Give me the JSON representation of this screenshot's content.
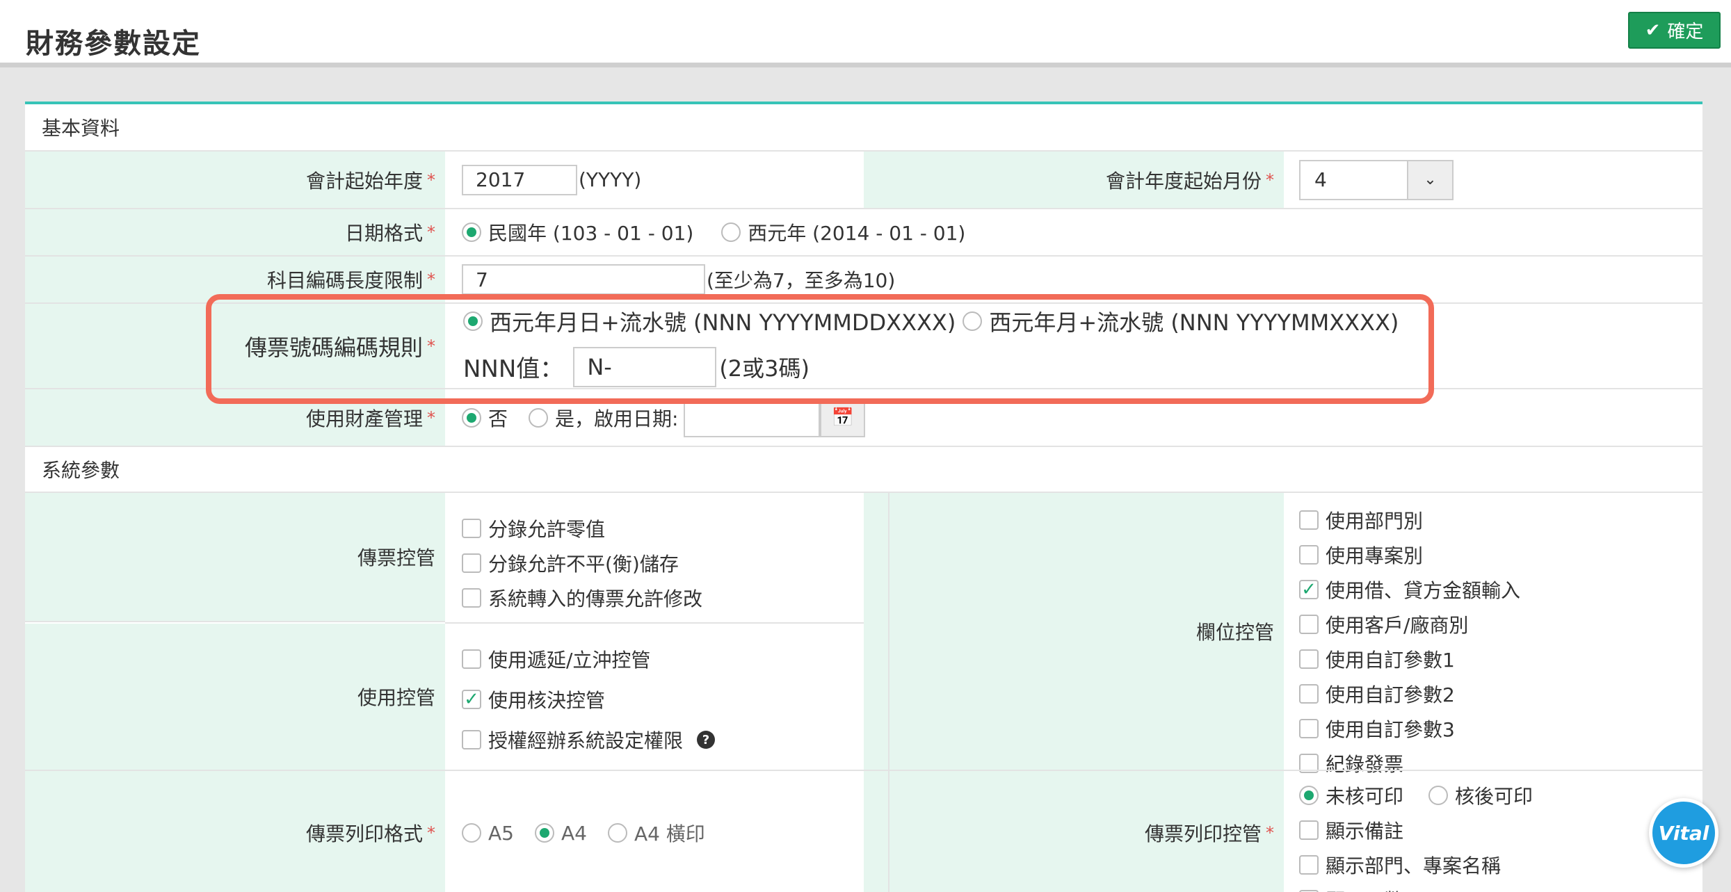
{
  "header": {
    "title": "財務參數設定",
    "confirm_label": "確定"
  },
  "basic": {
    "section_title": "基本資料",
    "fiscal_start_year": {
      "label": "會計起始年度",
      "value": "2017",
      "hint": "(YYYY)"
    },
    "fiscal_start_month": {
      "label": "會計年度起始月份",
      "value": "4"
    },
    "date_format": {
      "label": "日期格式",
      "options": [
        "民國年 (103 - 01 - 01)",
        "西元年 (2014 - 01 - 01)"
      ],
      "selected": 0
    },
    "account_code_length": {
      "label": "科目編碼長度限制",
      "value": "7",
      "hint": "(至少為7，至多為10)"
    },
    "voucher_number_rule": {
      "label": "傳票號碼編碼規則",
      "options": [
        "西元年月日+流水號 (NNN YYYYMMDDXXXX)",
        "西元年月+流水號 (NNN YYYYMMXXXX)"
      ],
      "selected": 0,
      "nnn_label": "NNN值：",
      "nnn_value": "N-",
      "nnn_hint": "(2或3碼)"
    },
    "asset_management": {
      "label": "使用財產管理",
      "options": [
        "否",
        "是，啟用日期:"
      ],
      "selected": 0,
      "date_value": ""
    }
  },
  "system": {
    "section_title": "系統參數",
    "voucher_control": {
      "label": "傳票控管",
      "items": [
        {
          "label": "分錄允許零值",
          "checked": false
        },
        {
          "label": "分錄允許不平(衡)儲存",
          "checked": false
        },
        {
          "label": "系統轉入的傳票允許修改",
          "checked": false
        }
      ]
    },
    "usage_control": {
      "label": "使用控管",
      "items": [
        {
          "label": "使用遞延/立沖控管",
          "checked": false
        },
        {
          "label": "使用核決控管",
          "checked": true
        },
        {
          "label": "授權經辦系統設定權限",
          "checked": false
        }
      ]
    },
    "field_control": {
      "label": "欄位控管",
      "items": [
        {
          "label": "使用部門別",
          "checked": false
        },
        {
          "label": "使用專案別",
          "checked": false
        },
        {
          "label": "使用借、貸方金額輸入",
          "checked": true
        },
        {
          "label": "使用客戶/廠商別",
          "checked": false
        },
        {
          "label": "使用自訂參數1",
          "checked": false
        },
        {
          "label": "使用自訂參數2",
          "checked": false
        },
        {
          "label": "使用自訂參數3",
          "checked": false
        },
        {
          "label": "紀錄發票",
          "checked": false
        }
      ]
    },
    "print_format": {
      "label": "傳票列印格式",
      "options": [
        "A5",
        "A4",
        "A4 橫印"
      ],
      "selected": 1
    },
    "print_control": {
      "label": "傳票列印控管",
      "radio_options": [
        "未核可印",
        "核後可印"
      ],
      "radio_selected": 0,
      "items": [
        {
          "label": "顯示備註",
          "checked": false
        },
        {
          "label": "顯示部門、專案名稱",
          "checked": false
        },
        {
          "label": "顯示原幣",
          "checked": false
        }
      ]
    }
  },
  "badge": {
    "text": "Vital"
  },
  "colors": {
    "accent": "#1da870",
    "label_bg": "#e6f6ef",
    "highlight": "#f26b58",
    "panel_top": "#37c4b7"
  }
}
